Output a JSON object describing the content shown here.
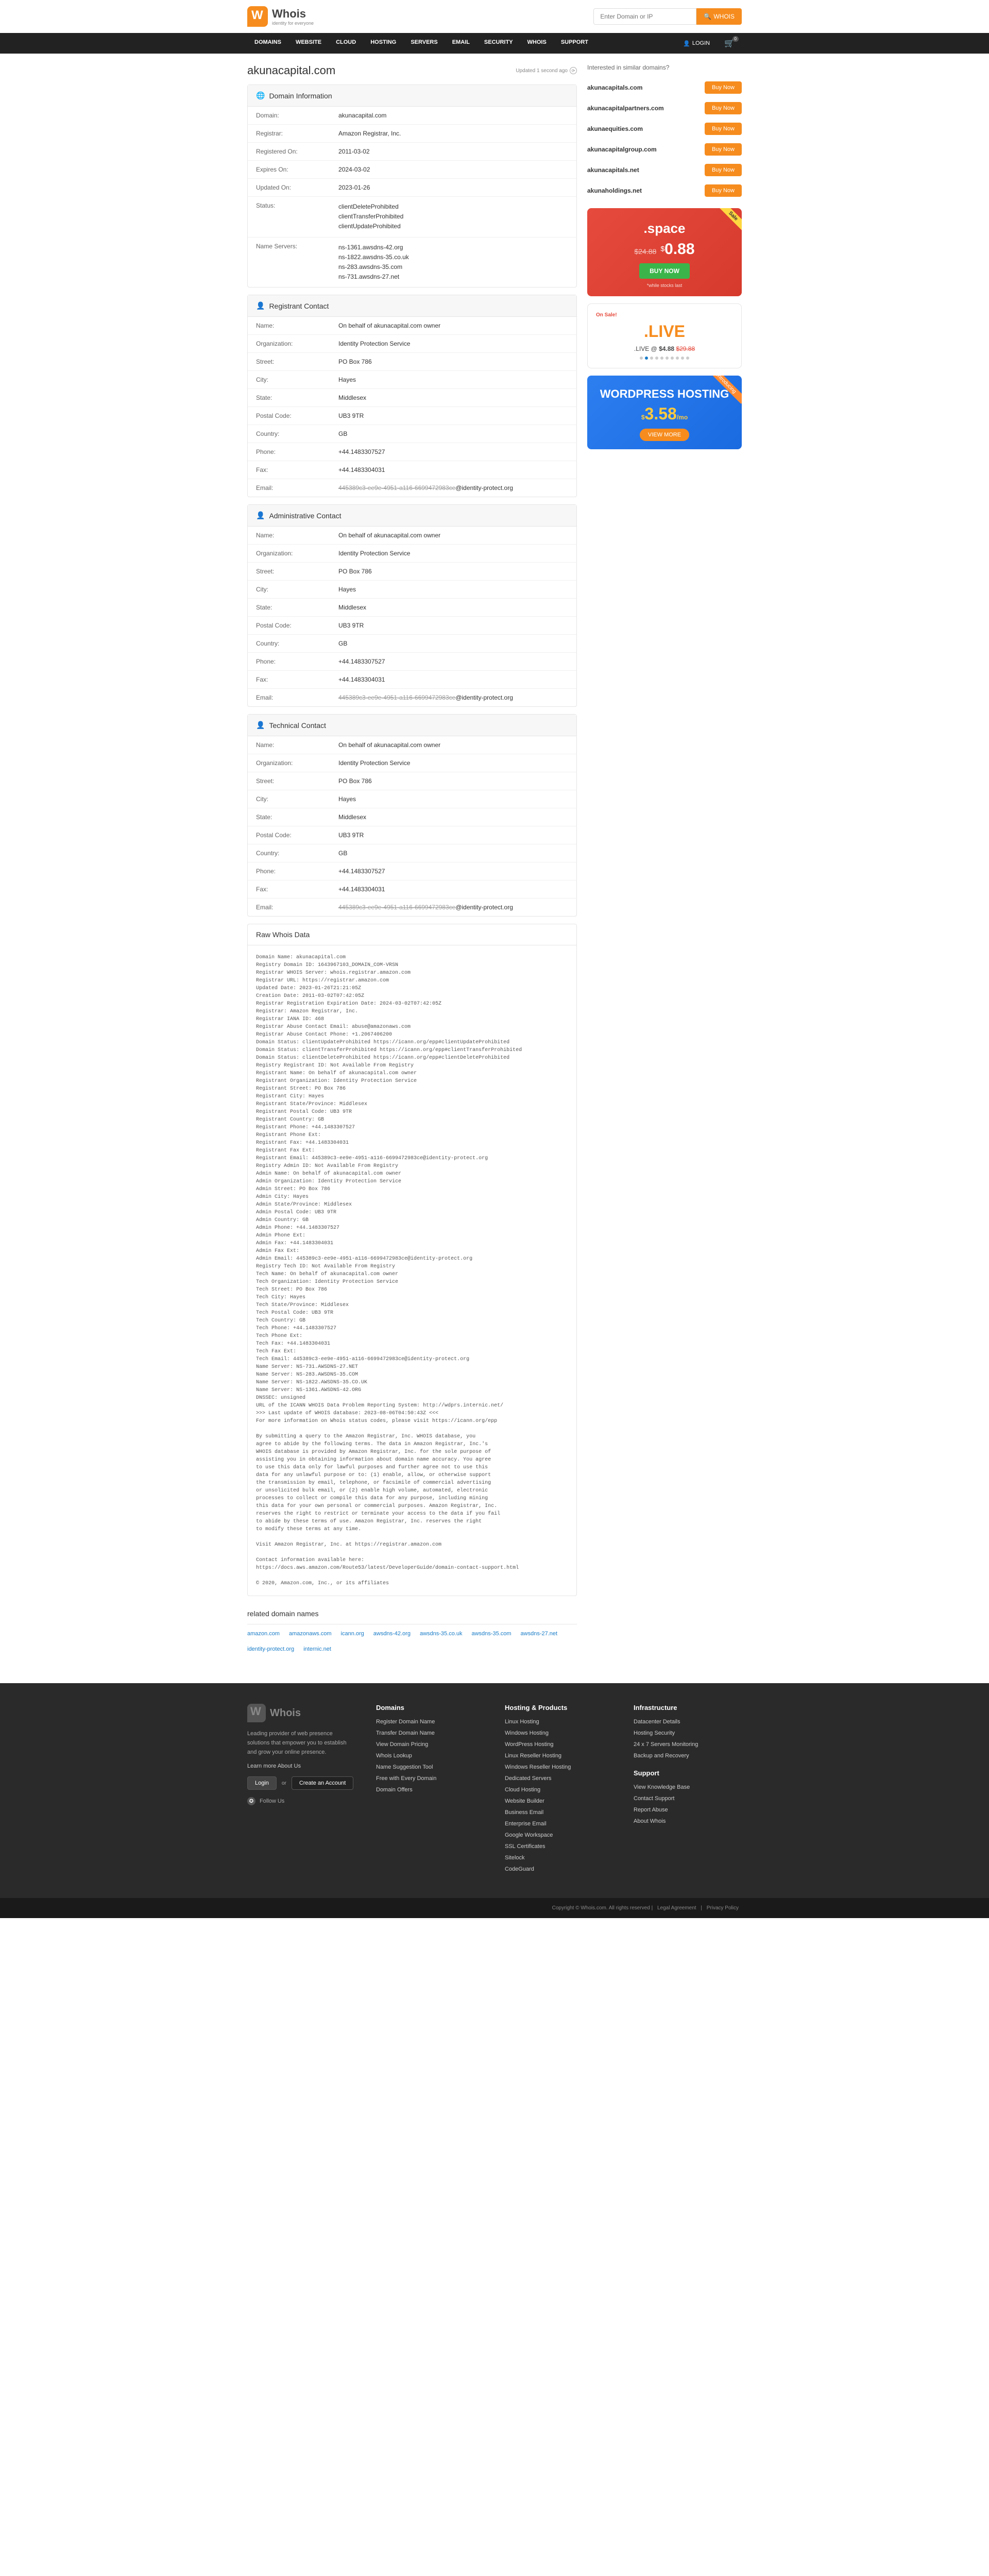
{
  "header": {
    "logo_text": "Whois",
    "logo_sub": "identity for everyone",
    "search_placeholder": "Enter Domain or IP",
    "search_btn": "WHOIS"
  },
  "nav": {
    "items": [
      "DOMAINS",
      "WEBSITE",
      "CLOUD",
      "HOSTING",
      "SERVERS",
      "EMAIL",
      "SECURITY",
      "WHOIS",
      "SUPPORT"
    ],
    "login": "LOGIN",
    "cart_count": "0"
  },
  "domain": {
    "name": "akunacapital.com",
    "updated": "Updated 1 second ago"
  },
  "sections": {
    "info": {
      "title": "Domain Information",
      "rows": [
        {
          "label": "Domain:",
          "value": "akunacapital.com"
        },
        {
          "label": "Registrar:",
          "value": "Amazon Registrar, Inc."
        },
        {
          "label": "Registered On:",
          "value": "2011-03-02"
        },
        {
          "label": "Expires On:",
          "value": "2024-03-02"
        },
        {
          "label": "Updated On:",
          "value": "2023-01-26"
        },
        {
          "label": "Status:",
          "value": "clientDeleteProhibited\nclientTransferProhibited\nclientUpdateProhibited"
        },
        {
          "label": "Name Servers:",
          "value": "ns-1361.awsdns-42.org\nns-1822.awsdns-35.co.uk\nns-283.awsdns-35.com\nns-731.awsdns-27.net"
        }
      ]
    },
    "registrant": {
      "title": "Registrant Contact",
      "rows": [
        {
          "label": "Name:",
          "value": "On behalf of akunacapital.com owner"
        },
        {
          "label": "Organization:",
          "value": "Identity Protection Service"
        },
        {
          "label": "Street:",
          "value": "PO Box 786"
        },
        {
          "label": "City:",
          "value": "Hayes"
        },
        {
          "label": "State:",
          "value": "Middlesex"
        },
        {
          "label": "Postal Code:",
          "value": "UB3 9TR"
        },
        {
          "label": "Country:",
          "value": "GB"
        },
        {
          "label": "Phone:",
          "value": "+44.1483307527"
        },
        {
          "label": "Fax:",
          "value": "+44.1483304031"
        },
        {
          "label": "Email:",
          "value_masked": "445389c3-ee9e-4951-a116-6699472983ce",
          "value_domain": "@identity-protect.org"
        }
      ]
    },
    "admin": {
      "title": "Administrative Contact",
      "rows": [
        {
          "label": "Name:",
          "value": "On behalf of akunacapital.com owner"
        },
        {
          "label": "Organization:",
          "value": "Identity Protection Service"
        },
        {
          "label": "Street:",
          "value": "PO Box 786"
        },
        {
          "label": "City:",
          "value": "Hayes"
        },
        {
          "label": "State:",
          "value": "Middlesex"
        },
        {
          "label": "Postal Code:",
          "value": "UB3 9TR"
        },
        {
          "label": "Country:",
          "value": "GB"
        },
        {
          "label": "Phone:",
          "value": "+44.1483307527"
        },
        {
          "label": "Fax:",
          "value": "+44.1483304031"
        },
        {
          "label": "Email:",
          "value_masked": "445389c3-ee9e-4951-a116-6699472983ce",
          "value_domain": "@identity-protect.org"
        }
      ]
    },
    "tech": {
      "title": "Technical Contact",
      "rows": [
        {
          "label": "Name:",
          "value": "On behalf of akunacapital.com owner"
        },
        {
          "label": "Organization:",
          "value": "Identity Protection Service"
        },
        {
          "label": "Street:",
          "value": "PO Box 786"
        },
        {
          "label": "City:",
          "value": "Hayes"
        },
        {
          "label": "State:",
          "value": "Middlesex"
        },
        {
          "label": "Postal Code:",
          "value": "UB3 9TR"
        },
        {
          "label": "Country:",
          "value": "GB"
        },
        {
          "label": "Phone:",
          "value": "+44.1483307527"
        },
        {
          "label": "Fax:",
          "value": "+44.1483304031"
        },
        {
          "label": "Email:",
          "value_masked": "445389c3-ee9e-4951-a116-6699472983ce",
          "value_domain": "@identity-protect.org"
        }
      ]
    },
    "raw": {
      "title": "Raw Whois Data",
      "body": "Domain Name: akunacapital.com\nRegistry Domain ID: 1643967103_DOMAIN_COM-VRSN\nRegistrar WHOIS Server: whois.registrar.amazon.com\nRegistrar URL: https://registrar.amazon.com\nUpdated Date: 2023-01-26T21:21:05Z\nCreation Date: 2011-03-02T07:42:05Z\nRegistrar Registration Expiration Date: 2024-03-02T07:42:05Z\nRegistrar: Amazon Registrar, Inc.\nRegistrar IANA ID: 468\nRegistrar Abuse Contact Email: abuse@amazonaws.com\nRegistrar Abuse Contact Phone: +1.2067406200\nDomain Status: clientUpdateProhibited https://icann.org/epp#clientUpdateProhibited\nDomain Status: clientTransferProhibited https://icann.org/epp#clientTransferProhibited\nDomain Status: clientDeleteProhibited https://icann.org/epp#clientDeleteProhibited\nRegistry Registrant ID: Not Available From Registry\nRegistrant Name: On behalf of akunacapital.com owner\nRegistrant Organization: Identity Protection Service\nRegistrant Street: PO Box 786\nRegistrant City: Hayes\nRegistrant State/Province: Middlesex\nRegistrant Postal Code: UB3 9TR\nRegistrant Country: GB\nRegistrant Phone: +44.1483307527\nRegistrant Phone Ext:\nRegistrant Fax: +44.1483304031\nRegistrant Fax Ext:\nRegistrant Email: 445389c3-ee9e-4951-a116-6699472983ce@identity-protect.org\nRegistry Admin ID: Not Available From Registry\nAdmin Name: On behalf of akunacapital.com owner\nAdmin Organization: Identity Protection Service\nAdmin Street: PO Box 786\nAdmin City: Hayes\nAdmin State/Province: Middlesex\nAdmin Postal Code: UB3 9TR\nAdmin Country: GB\nAdmin Phone: +44.1483307527\nAdmin Phone Ext:\nAdmin Fax: +44.1483304031\nAdmin Fax Ext:\nAdmin Email: 445389c3-ee9e-4951-a116-6699472983ce@identity-protect.org\nRegistry Tech ID: Not Available From Registry\nTech Name: On behalf of akunacapital.com owner\nTech Organization: Identity Protection Service\nTech Street: PO Box 786\nTech City: Hayes\nTech State/Province: Middlesex\nTech Postal Code: UB3 9TR\nTech Country: GB\nTech Phone: +44.1483307527\nTech Phone Ext:\nTech Fax: +44.1483304031\nTech Fax Ext:\nTech Email: 445389c3-ee9e-4951-a116-6699472983ce@identity-protect.org\nName Server: NS-731.AWSDNS-27.NET\nName Server: NS-283.AWSDNS-35.COM\nName Server: NS-1822.AWSDNS-35.CO.UK\nName Server: NS-1361.AWSDNS-42.ORG\nDNSSEC: unsigned\nURL of the ICANN WHOIS Data Problem Reporting System: http://wdprs.internic.net/\n>>> Last update of WHOIS database: 2023-08-06T04:50:43Z <<<\nFor more information on Whois status codes, please visit https://icann.org/epp\n\nBy submitting a query to the Amazon Registrar, Inc. WHOIS database, you\nagree to abide by the following terms. The data in Amazon Registrar, Inc.'s\nWHOIS database is provided by Amazon Registrar, Inc. for the sole purpose of\nassisting you in obtaining information about domain name accuracy. You agree\nto use this data only for lawful purposes and further agree not to use this\ndata for any unlawful purpose or to: (1) enable, allow, or otherwise support\nthe transmission by email, telephone, or facsimile of commercial advertising\nor unsolicited bulk email, or (2) enable high volume, automated, electronic\nprocesses to collect or compile this data for any purpose, including mining\nthis data for your own personal or commercial purposes. Amazon Registrar, Inc.\nreserves the right to restrict or terminate your access to the data if you fail\nto abide by these terms of use. Amazon Registrar, Inc. reserves the right\nto modify these terms at any time.\n\nVisit Amazon Registrar, Inc. at https://registrar.amazon.com\n\nContact information available here:\nhttps://docs.aws.amazon.com/Route53/latest/DeveloperGuide/domain-contact-support.html\n\n© 2020, Amazon.com, Inc., or its affiliates"
    }
  },
  "related": {
    "title": "related domain names",
    "links": [
      "amazon.com",
      "amazonaws.com",
      "icann.org",
      "awsdns-42.org",
      "awsdns-35.co.uk",
      "awsdns-35.com",
      "awsdns-27.net",
      "identity-protect.org",
      "internic.net"
    ]
  },
  "similar": {
    "title": "Interested in similar domains?",
    "items": [
      {
        "domain": "akunacapitals.com",
        "btn": "Buy Now"
      },
      {
        "domain": "akunacapitalpartners.com",
        "btn": "Buy Now"
      },
      {
        "domain": "akunaequities.com",
        "btn": "Buy Now"
      },
      {
        "domain": "akunacapitalgroup.com",
        "btn": "Buy Now"
      },
      {
        "domain": "akunacapitals.net",
        "btn": "Buy Now"
      },
      {
        "domain": "akunaholdings.net",
        "btn": "Buy Now"
      }
    ]
  },
  "promos": {
    "space": {
      "badge": "Sale",
      "tld": ".space",
      "old": "$24.88",
      "cur": "$",
      "new": "0.88",
      "buy": "BUY NOW",
      "note": "*while stocks last"
    },
    "live": {
      "onsale": "On Sale!",
      "tld": ".LIVE",
      "line_pre": ".LIVE @ ",
      "price": "$4.88",
      "old": "$29.88"
    },
    "wp": {
      "badge": "Introducing",
      "title": "WORDPRESS HOSTING",
      "cur": "$",
      "price": "3.58",
      "per": "/mo",
      "btn": "VIEW MORE"
    }
  },
  "footer": {
    "logo_text": "Whois",
    "desc": "Leading provider of web presence solutions that empower you to establish and grow your online presence.",
    "about": "Learn more About Us",
    "login": "Login",
    "or": "or",
    "create": "Create an Account",
    "follow": "Follow Us",
    "cols": [
      {
        "heading": "Domains",
        "links": [
          "Register Domain Name",
          "Transfer Domain Name",
          "View Domain Pricing",
          "Whois Lookup",
          "Name Suggestion Tool",
          "Free with Every Domain",
          "Domain Offers"
        ]
      },
      {
        "heading": "Hosting & Products",
        "links": [
          "Linux Hosting",
          "Windows Hosting",
          "WordPress Hosting",
          "Linux Reseller Hosting",
          "Windows Reseller Hosting",
          "Dedicated Servers",
          "Cloud Hosting",
          "Website Builder",
          "Business Email",
          "Enterprise Email",
          "Google Workspace",
          "SSL Certificates",
          "Sitelock",
          "CodeGuard"
        ]
      },
      {
        "heading": "Infrastructure",
        "links": [
          "Datacenter Details",
          "Hosting Security",
          "24 x 7 Servers Monitoring",
          "Backup and Recovery"
        ],
        "heading2": "Support",
        "links2": [
          "View Knowledge Base",
          "Contact Support",
          "Report Abuse",
          "About Whois"
        ]
      }
    ],
    "copyright": "Copyright © Whois.com. All rights reserved",
    "legal": "Legal Agreement",
    "privacy": "Privacy Policy"
  }
}
